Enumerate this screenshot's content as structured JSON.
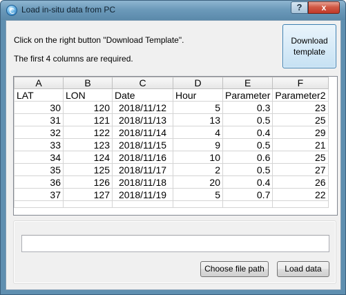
{
  "window": {
    "title": "Load in-situ data from PC",
    "help_label": "?",
    "close_label": "x",
    "app_icon": "app-globe-icon"
  },
  "instructions": {
    "line1": "Click on the right button \"Download Template\".",
    "line2": "The first 4 columns are required."
  },
  "download_button": {
    "label": "Download template"
  },
  "grid": {
    "column_letters": [
      "A",
      "B",
      "C",
      "D",
      "E",
      "F"
    ],
    "header_row": [
      "LAT",
      "LON",
      "Date",
      "Hour",
      "Parameter",
      "Parameter2"
    ],
    "rows": [
      [
        "30",
        "120",
        "2018/11/12",
        "5",
        "0.3",
        "23"
      ],
      [
        "31",
        "121",
        "2018/11/13",
        "13",
        "0.5",
        "25"
      ],
      [
        "32",
        "122",
        "2018/11/14",
        "4",
        "0.4",
        "29"
      ],
      [
        "33",
        "123",
        "2018/11/15",
        "9",
        "0.5",
        "21"
      ],
      [
        "34",
        "124",
        "2018/11/16",
        "10",
        "0.6",
        "25"
      ],
      [
        "35",
        "125",
        "2018/11/17",
        "2",
        "0.5",
        "27"
      ],
      [
        "36",
        "126",
        "2018/11/18",
        "20",
        "0.4",
        "26"
      ],
      [
        "37",
        "127",
        "2018/11/19",
        "5",
        "0.7",
        "22"
      ]
    ]
  },
  "file_path": {
    "value": "",
    "placeholder": ""
  },
  "buttons": {
    "choose_file": "Choose file path",
    "load_data": "Load data"
  },
  "colors": {
    "titlebar": "#6c9aba",
    "close_button": "#c1392a",
    "download_button": "#d8ebf8",
    "client_background": "#f0f0f0"
  }
}
